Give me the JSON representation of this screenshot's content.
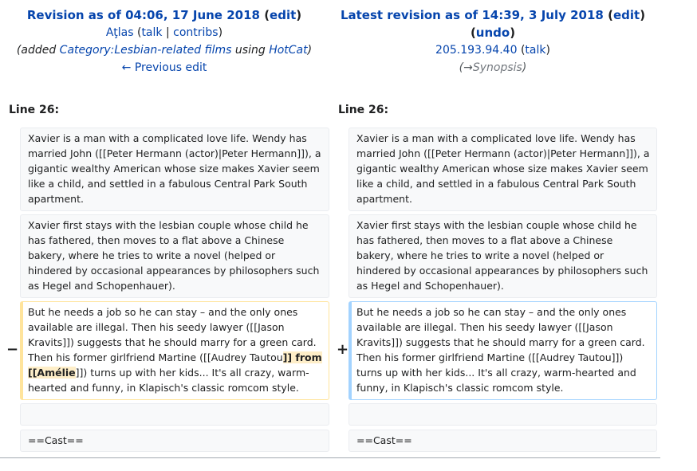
{
  "left": {
    "title_prefix": "Revision as of 04:06, 17 June 2018",
    "edit": "edit",
    "user": "Aţlas",
    "talk": "talk",
    "contribs": "contribs",
    "summary_pre": "(added ",
    "summary_link": "Category:Lesbian-related films",
    "summary_mid": " using ",
    "summary_tool": "HotCat",
    "summary_post": ")",
    "prev_link": "← Previous edit"
  },
  "right": {
    "title_prefix": "Latest revision as of 14:39, 3 July 2018",
    "edit": "edit",
    "undo": "undo",
    "user": "205.193.94.40",
    "talk": "talk",
    "summary_arrow": "(→",
    "summary_section": "Synopsis",
    "summary_close": ")"
  },
  "line_left": "Line 26:",
  "line_right": "Line 26:",
  "context1": "Xavier is a man with a complicated love life. Wendy has married John ([[Peter Hermann (actor)|Peter Hermann]]), a gigantic wealthy American whose size makes Xavier seem like a child, and settled in a fabulous Central Park South apartment.",
  "context2": "Xavier first stays with the lesbian couple whose child he has fathered, then moves to a flat above a Chinese bakery, where he tries to write a novel (helped or hindered by occasional appearances by philosophers such as Hegel and Schopenhauer).",
  "deleted": {
    "pre": "But he needs a job so he can stay – and the only ones available are illegal. Then his seedy lawyer ([[Jason Kravits]]) suggests that he should marry for a green card. Then his former girlfriend Martine ([[Audrey Tautou",
    "highlight": "]] from [[Amélie",
    "post": "]]) turns up with her kids... It's all crazy, warm-hearted and funny, in Klapisch's classic romcom style."
  },
  "added": "But he needs a job so he can stay – and the only ones available are illegal. Then his seedy lawyer ([[Jason Kravits]]) suggests that he should marry for a green card. Then his former girlfriend Martine ([[Audrey Tautou]]) turns up with her kids... It's all crazy, warm-hearted and funny, in Klapisch's classic romcom style.",
  "minus": "−",
  "plus": "+",
  "cast": "==Cast=="
}
